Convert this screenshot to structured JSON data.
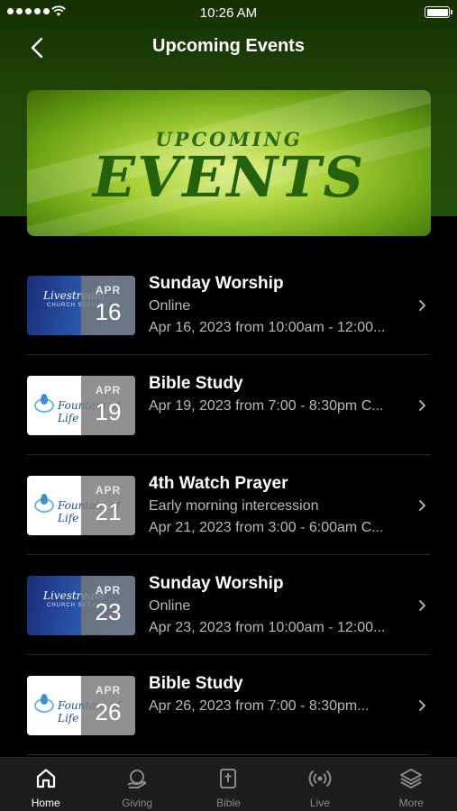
{
  "status_bar": {
    "time": "10:26 AM"
  },
  "header": {
    "title": "Upcoming Events"
  },
  "banner": {
    "subtitle": "UPCOMING",
    "title": "EVENTS"
  },
  "events": [
    {
      "title": "Sunday Worship",
      "subtitle": "Online",
      "date_text": "Apr 16, 2023 from 10:00am - 12:00...",
      "month": "APR",
      "day": "16",
      "thumb": "livestream",
      "thumb_text": "Livestream",
      "thumb_sub": "CHURCH SERVICE"
    },
    {
      "title": "Bible Study",
      "subtitle": "",
      "date_text": "Apr 19, 2023 from 7:00 - 8:30pm C...",
      "month": "APR",
      "day": "19",
      "thumb": "fountain",
      "thumb_text": "Fountain of Life"
    },
    {
      "title": "4th Watch Prayer",
      "subtitle": "Early morning intercession",
      "date_text": "Apr 21, 2023 from 3:00 - 6:00am C...",
      "month": "APR",
      "day": "21",
      "thumb": "fountain",
      "thumb_text": "Fountain of Life"
    },
    {
      "title": "Sunday Worship",
      "subtitle": "Online",
      "date_text": "Apr 23, 2023 from 10:00am - 12:00...",
      "month": "APR",
      "day": "23",
      "thumb": "livestream",
      "thumb_text": "Livestream",
      "thumb_sub": "CHURCH SERVICE"
    },
    {
      "title": "Bible Study",
      "subtitle": "",
      "date_text": "Apr 26, 2023 from 7:00 - 8:30pm...",
      "month": "APR",
      "day": "26",
      "thumb": "fountain",
      "thumb_text": "Fountain of Life"
    }
  ],
  "tabs": [
    {
      "label": "Home",
      "icon": "home-icon",
      "active": true
    },
    {
      "label": "Giving",
      "icon": "giving-icon",
      "active": false
    },
    {
      "label": "Bible",
      "icon": "bible-icon",
      "active": false
    },
    {
      "label": "Live",
      "icon": "live-icon",
      "active": false
    },
    {
      "label": "More",
      "icon": "layers-icon",
      "active": false
    }
  ],
  "colors": {
    "header_green": "#1f4508",
    "banner_green": "#a9d238",
    "background": "#000000",
    "tab_bar": "#1d1d1d"
  }
}
